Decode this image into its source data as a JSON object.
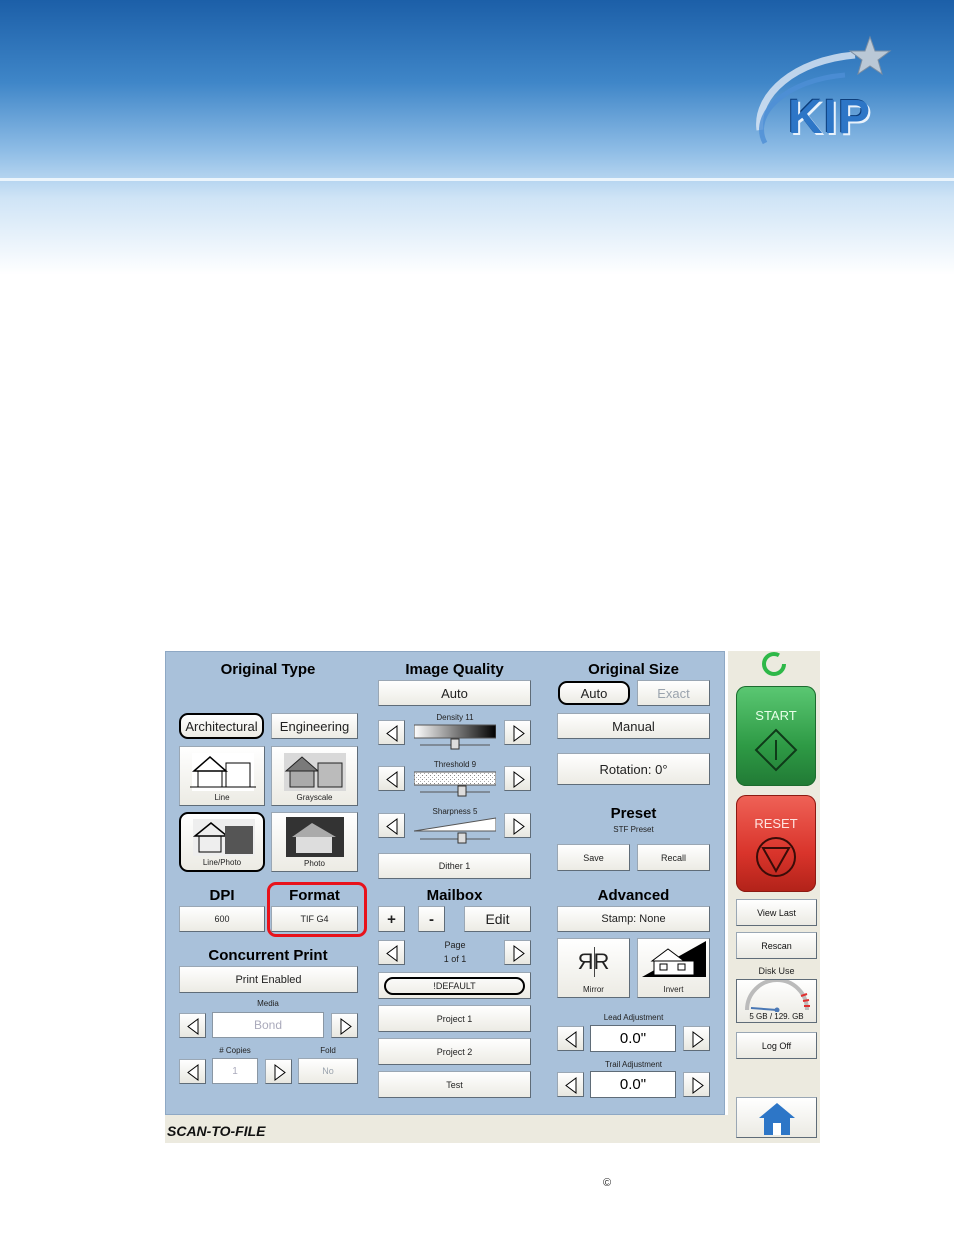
{
  "brand": {
    "logo_text": "KIP"
  },
  "status_bar": {
    "label": "SCAN-TO-FILE"
  },
  "original_type": {
    "title": "Original Type",
    "architectural": "Architectural",
    "engineering": "Engineering",
    "tiles": {
      "line": "Line",
      "grayscale": "Grayscale",
      "line_photo": "Line/Photo",
      "photo": "Photo"
    }
  },
  "dpi": {
    "title": "DPI",
    "value": "600"
  },
  "format": {
    "title": "Format",
    "value": "TIF G4"
  },
  "concurrent_print": {
    "title": "Concurrent Print",
    "toggle": "Print Enabled",
    "media_label": "Media",
    "media_value": "Bond",
    "copies_label": "# Copies",
    "copies_value": "1",
    "fold_label": "Fold",
    "fold_value": "No"
  },
  "image_quality": {
    "title": "Image Quality",
    "mode": "Auto",
    "density_label": "Density 11",
    "density_level": 0.5,
    "threshold_label": "Threshold 9",
    "threshold_level": 0.6,
    "sharpness_label": "Sharpness 5",
    "sharpness_level": 0.6,
    "dither": "Dither 1"
  },
  "mailbox": {
    "title": "Mailbox",
    "add": "+",
    "remove": "-",
    "edit": "Edit",
    "page_label": "Page",
    "page_value": "1 of 1",
    "items": [
      "!DEFAULT",
      "Project 1",
      "Project 2",
      "Test"
    ]
  },
  "original_size": {
    "title": "Original Size",
    "auto": "Auto",
    "exact": "Exact",
    "manual": "Manual",
    "rotation": "Rotation: 0°"
  },
  "preset": {
    "title": "Preset",
    "subtitle": "STF Preset",
    "save": "Save",
    "recall": "Recall"
  },
  "advanced": {
    "title": "Advanced",
    "stamp": "Stamp: None",
    "mirror": "Mirror",
    "mirror_glyph": "ЯR",
    "invert": "Invert",
    "lead_label": "Lead Adjustment",
    "lead_value": "0.0\"",
    "trail_label": "Trail Adjustment",
    "trail_value": "0.0\""
  },
  "sidebar": {
    "start": "START",
    "reset": "RESET",
    "view_last": "View Last",
    "rescan": "Rescan",
    "disk_use_label": "Disk Use",
    "disk_use_value": "5 GB / 129. GB",
    "log_off": "Log Off"
  },
  "footer": {
    "copyright": "©"
  },
  "colors": {
    "start": "#2e9a45",
    "reset": "#d9342b",
    "panel": "#a9c1da",
    "highlight": "#e8121b"
  }
}
